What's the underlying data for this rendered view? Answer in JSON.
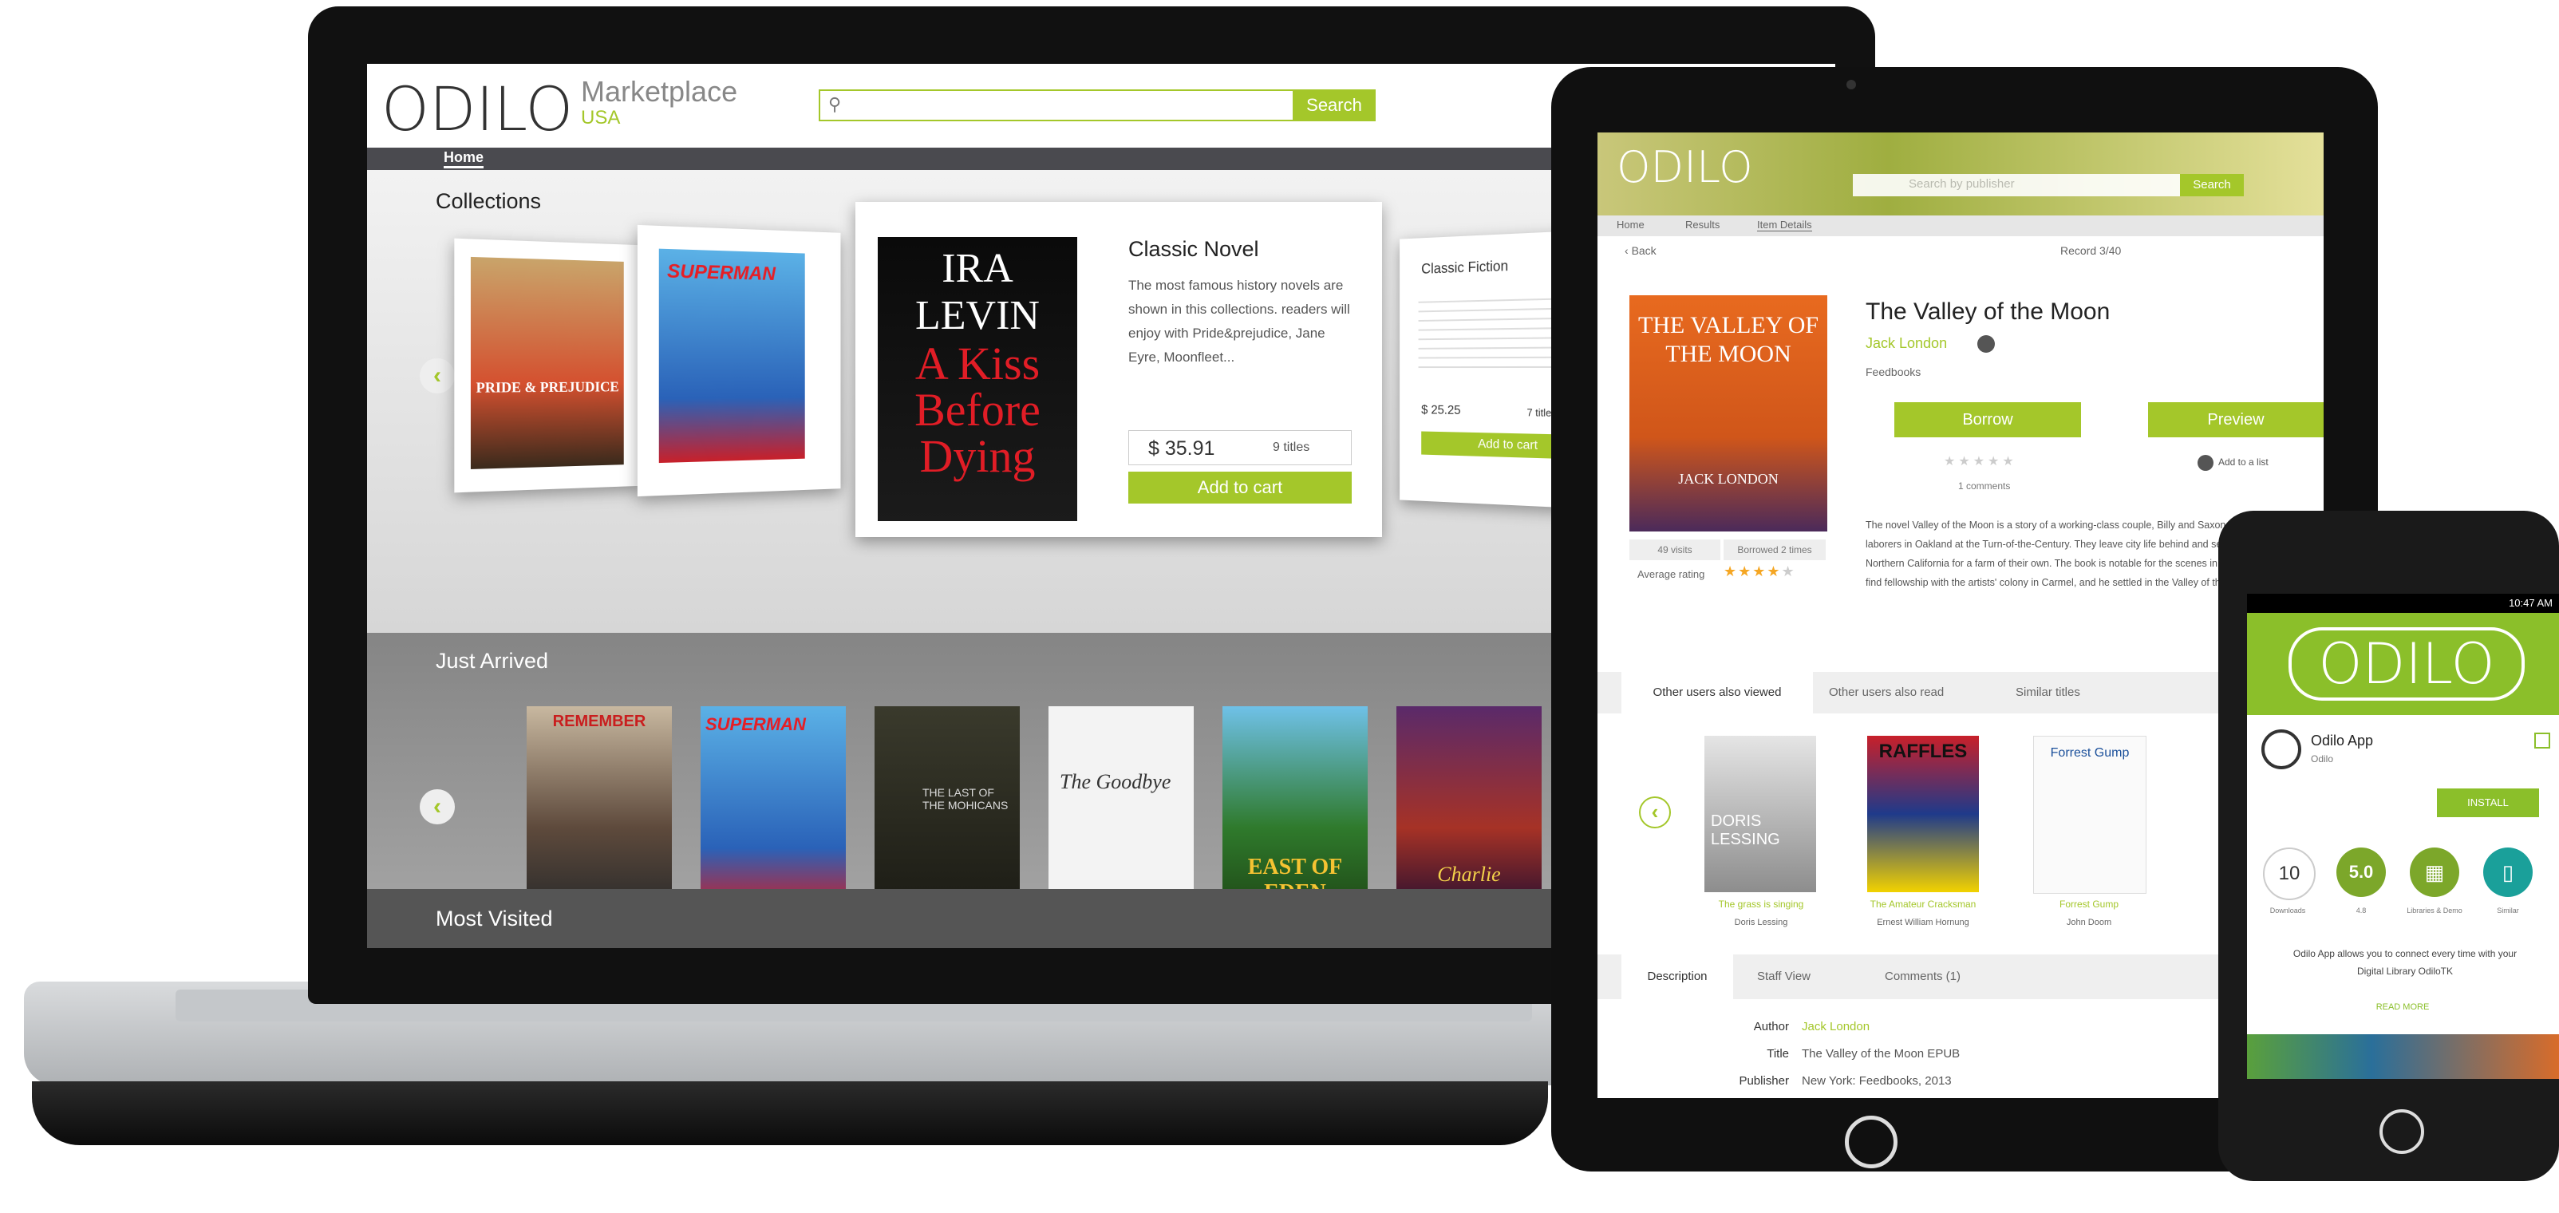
{
  "laptop": {
    "brand": "ODILO",
    "marketplace": "Marketplace",
    "region": "USA",
    "search_button": "Search",
    "search_icon": "search-icon",
    "nav_home": "Home",
    "collections_heading": "Collections",
    "featured": {
      "title": "Classic Novel",
      "description": "The most famous history novels are shown in this collections. readers will enjoy with Pride&prejudice, Jane Eyre, Moonfleet...",
      "price": "$ 35.91",
      "titles": "9 titles",
      "add_to_cart": "Add to cart",
      "cover_text": "IRA LEVIN",
      "cover_title": "A Kiss Before Dying"
    },
    "side_card": {
      "title": "Classic Fiction",
      "price": "$ 25.25",
      "titles": "7 titles",
      "add_to_cart": "Add to cart"
    },
    "left_covers": [
      "PRIDE & PREJUDICE",
      "SUPERMAN"
    ],
    "just_arrived_heading": "Just Arrived",
    "just_arrived_covers": [
      "REMEMBER",
      "SUPERMAN",
      "THE LAST OF THE MOHICANS",
      "The Goodbye",
      "EAST OF EDEN",
      "Charlie"
    ],
    "most_visited_heading": "Most Visited"
  },
  "tablet": {
    "brand": "ODILO",
    "search_placeholder": "Search by publisher",
    "search_button": "Search",
    "breadcrumb": [
      "Home",
      "Results",
      "Item Details"
    ],
    "back": "Back",
    "result_counter": "Record 3/40",
    "book": {
      "title": "The Valley of the Moon",
      "author": "Jack London",
      "publisher": "Feedbooks",
      "cover_title": "THE VALLEY OF THE MOON",
      "cover_author": "JACK LONDON",
      "borrow": "Borrow",
      "preview": "Preview",
      "comments": "1 comments",
      "add_to_list": "Add to a list",
      "stats": [
        "49 visits",
        "Borrowed 2 times"
      ],
      "average_rating_label": "Average rating",
      "rating": 4,
      "description": "The novel Valley of the Moon is a story of a working-class couple, Billy and Saxon Roberts, struggling laborers in Oakland at the Turn-of-the-Century. They leave city life behind and searched Central and Northern California for a farm of their own. The book is notable for the scenes in which the protagonists find fellowship with the artists' colony in Carmel, and he settled in the Valley of the Moon."
    },
    "rec_tabs": [
      "Other users also viewed",
      "Other users also read",
      "Similar titles"
    ],
    "recommendations": [
      {
        "title": "The grass is singing",
        "author": "Doris Lessing",
        "cover": "DORIS LESSING"
      },
      {
        "title": "The Amateur Cracksman",
        "author": "Ernest William Hornung",
        "cover": "RAFFLES"
      },
      {
        "title": "Forrest Gump",
        "author": "John Doom",
        "cover": "Forrest Gump"
      }
    ],
    "detail_tabs": [
      "Description",
      "Staff View",
      "Comments (1)"
    ],
    "details": [
      {
        "label": "Author",
        "value": "Jack London"
      },
      {
        "label": "Title",
        "value": "The Valley of the Moon EPUB"
      },
      {
        "label": "Publisher",
        "value": "New York: Feedbooks, 2013"
      }
    ]
  },
  "phone": {
    "status_time": "10:47 AM",
    "brand": "ODILO",
    "app_name": "Odilo App",
    "app_publisher": "Odilo",
    "install": "INSTALL",
    "badges": [
      {
        "value": "10",
        "label": "Downloads"
      },
      {
        "value": "5.0",
        "label": "4.8"
      },
      {
        "value": "",
        "label": "Libraries & Demo"
      },
      {
        "value": "",
        "label": "Similar"
      }
    ],
    "description": "Odilo App allows you to connect every time with your Digital Library OdiloTK",
    "read_more": "READ MORE"
  },
  "colors": {
    "accent": "#a4c72a",
    "nav": "#4a4a4f"
  }
}
